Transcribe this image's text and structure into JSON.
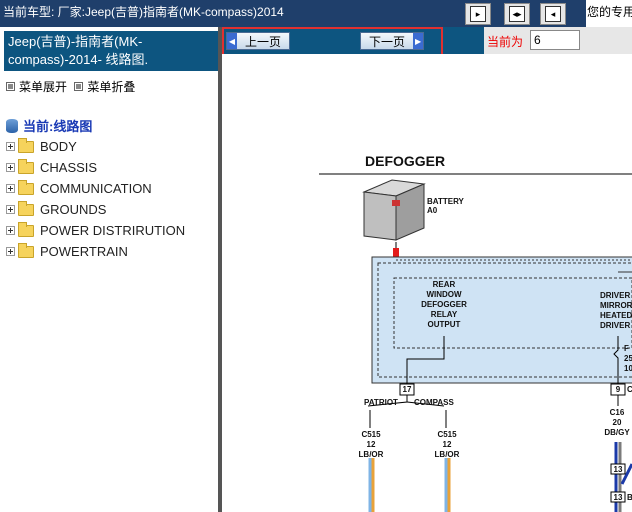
{
  "topbar": {
    "title": "当前车型:  厂家:Jeep(吉普)指南者(MK-compass)2014",
    "welcome": "您的专用",
    "colors": {
      "background": "#1f3f6b"
    }
  },
  "left_panel": {
    "header": "Jeep(吉普)-指南者(MK-compass)-2014- 线路图.",
    "expand_label": "菜单展开",
    "collapse_label": "菜单折叠",
    "current_label": "当前:线路图",
    "tree_items": [
      "BODY",
      "CHASSIS",
      "COMMUNICATION",
      "GROUNDS",
      "POWER DISTRIRUTION",
      "POWERTRAIN"
    ]
  },
  "nav": {
    "prev_label": "上一页",
    "next_label": "下一页",
    "page_label": "当前为",
    "page_value": "6"
  },
  "diagram": {
    "title": "DEFOGGER",
    "battery_label": "BATTERY",
    "battery_sub": "A0",
    "relay_lines": [
      "REAR",
      "WINDOW",
      "DEFOGGER",
      "RELAY",
      "OUTPUT"
    ],
    "right_lines": [
      "DRIVER",
      "MIRROR",
      "HEATED",
      "DRIVER"
    ],
    "fuse_lines": [
      "F",
      "25",
      "10"
    ],
    "pin_17": "17",
    "pin_9": "9",
    "pin_9_suffix": "C",
    "patriot": "PATRIOT",
    "compass": "COMPASS",
    "wire_left": [
      "C515",
      "12",
      "LB/OR"
    ],
    "wire_mid": [
      "C515",
      "12",
      "LB/OR"
    ],
    "wire_right": [
      "C16",
      "20",
      "DB/GY"
    ],
    "pin_13a": "13",
    "pin_13b": "13",
    "pin_13_suffix": "B"
  }
}
